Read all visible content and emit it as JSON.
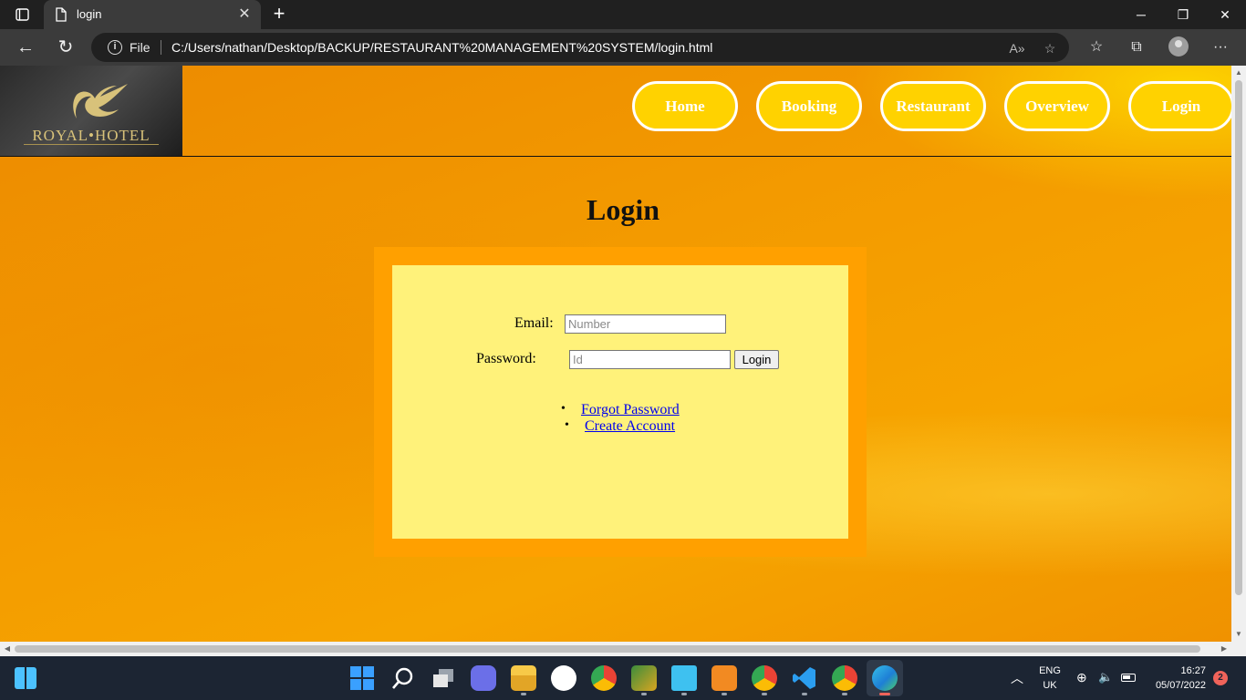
{
  "browser": {
    "tab_title": "login",
    "file_label": "File",
    "url": "C:/Users/nathan/Desktop/BACKUP/RESTAURANT%20MANAGEMENT%20SYSTEM/login.html"
  },
  "site": {
    "logo_text": "ROYAL•HOTEL",
    "nav": [
      {
        "label": "Home"
      },
      {
        "label": "Booking"
      },
      {
        "label": "Restaurant"
      },
      {
        "label": "Overview"
      },
      {
        "label": "Login"
      }
    ],
    "nav_color": "#ffd200"
  },
  "login": {
    "title": "Login",
    "email_label": "Email:",
    "email_placeholder": "Number",
    "password_label": "Password:",
    "password_placeholder": "Id",
    "submit_label": "Login",
    "links": [
      {
        "label": "Forgot Password"
      },
      {
        "label": "Create Account"
      }
    ]
  },
  "taskbar": {
    "language": "ENG",
    "region": "UK",
    "time": "16:27",
    "date": "05/07/2022",
    "notifications": "2"
  }
}
